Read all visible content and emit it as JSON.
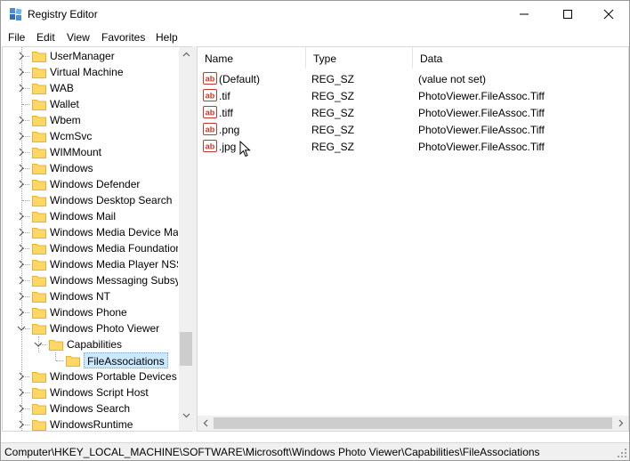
{
  "window": {
    "title": "Registry Editor"
  },
  "menu": [
    "File",
    "Edit",
    "View",
    "Favorites",
    "Help"
  ],
  "tree": {
    "items": [
      {
        "label": "UserManager",
        "level": 1,
        "expander": "collapsed"
      },
      {
        "label": "Virtual Machine",
        "level": 1,
        "expander": "collapsed"
      },
      {
        "label": "WAB",
        "level": 1,
        "expander": "collapsed"
      },
      {
        "label": "Wallet",
        "level": 1,
        "expander": "none"
      },
      {
        "label": "Wbem",
        "level": 1,
        "expander": "collapsed"
      },
      {
        "label": "WcmSvc",
        "level": 1,
        "expander": "collapsed"
      },
      {
        "label": "WIMMount",
        "level": 1,
        "expander": "collapsed"
      },
      {
        "label": "Windows",
        "level": 1,
        "expander": "collapsed"
      },
      {
        "label": "Windows Defender",
        "level": 1,
        "expander": "collapsed"
      },
      {
        "label": "Windows Desktop Search",
        "level": 1,
        "expander": "none"
      },
      {
        "label": "Windows Mail",
        "level": 1,
        "expander": "collapsed"
      },
      {
        "label": "Windows Media Device Ma",
        "level": 1,
        "expander": "collapsed"
      },
      {
        "label": "Windows Media Foundation",
        "level": 1,
        "expander": "collapsed"
      },
      {
        "label": "Windows Media Player NSS",
        "level": 1,
        "expander": "collapsed"
      },
      {
        "label": "Windows Messaging Subsy",
        "level": 1,
        "expander": "collapsed"
      },
      {
        "label": "Windows NT",
        "level": 1,
        "expander": "collapsed"
      },
      {
        "label": "Windows Phone",
        "level": 1,
        "expander": "collapsed"
      },
      {
        "label": "Windows Photo Viewer",
        "level": 1,
        "expander": "expanded"
      },
      {
        "label": "Capabilities",
        "level": 2,
        "expander": "expanded"
      },
      {
        "label": "FileAssociations",
        "level": 3,
        "expander": "none",
        "selected": true
      },
      {
        "label": "Windows Portable Devices",
        "level": 1,
        "expander": "collapsed"
      },
      {
        "label": "Windows Script Host",
        "level": 1,
        "expander": "collapsed"
      },
      {
        "label": "Windows Search",
        "level": 1,
        "expander": "collapsed"
      },
      {
        "label": "WindowsRuntime",
        "level": 1,
        "expander": "collapsed"
      }
    ]
  },
  "values": {
    "columns": [
      "Name",
      "Type",
      "Data"
    ],
    "rows": [
      {
        "name": "(Default)",
        "type": "REG_SZ",
        "data": "(value not set)",
        "icon": "string-value-icon"
      },
      {
        "name": ".tif",
        "type": "REG_SZ",
        "data": "PhotoViewer.FileAssoc.Tiff",
        "icon": "string-value-icon"
      },
      {
        "name": ".tiff",
        "type": "REG_SZ",
        "data": "PhotoViewer.FileAssoc.Tiff",
        "icon": "string-value-icon"
      },
      {
        "name": ".png",
        "type": "REG_SZ",
        "data": "PhotoViewer.FileAssoc.Tiff",
        "icon": "string-value-icon"
      },
      {
        "name": ".jpg",
        "type": "REG_SZ",
        "data": "PhotoViewer.FileAssoc.Tiff",
        "icon": "string-value-icon"
      }
    ]
  },
  "status": {
    "path": "Computer\\HKEY_LOCAL_MACHINE\\SOFTWARE\\Microsoft\\Windows Photo Viewer\\Capabilities\\FileAssociations"
  },
  "colors": {
    "selection": "#cce8ff",
    "folder": "#ffd767",
    "folder_dark": "#e8b23a",
    "scrollbar": "#cdcdcd"
  }
}
